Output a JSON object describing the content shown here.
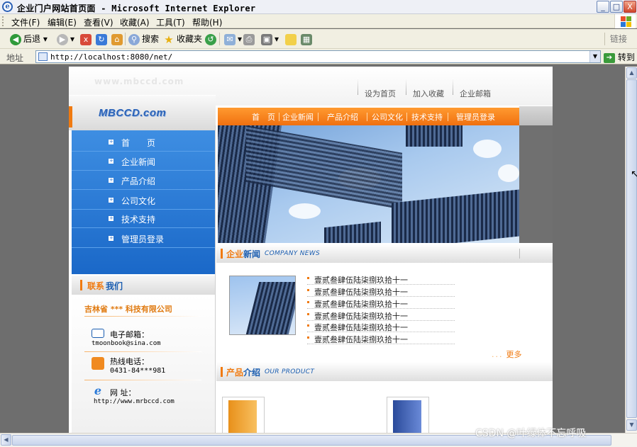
{
  "window": {
    "title": "企业门户网站首页面 - Microsoft Internet Explorer",
    "buttons": [
      "_",
      "□",
      "X"
    ]
  },
  "menu": [
    "文件(F)",
    "编辑(E)",
    "查看(V)",
    "收藏(A)",
    "工具(T)",
    "帮助(H)"
  ],
  "toolbar": {
    "back": "后退",
    "search": "搜索",
    "favorites": "收藏夹",
    "links": "链接"
  },
  "address": {
    "label": "地址",
    "url": "http://localhost:8080/net/",
    "go": "转到"
  },
  "site": {
    "watermark": "www.mbccd.com",
    "top_links": [
      "设为首页",
      "加入收藏",
      "企业邮箱"
    ],
    "logo": "MBCCD.com",
    "nav": [
      "首　页",
      "企业新闻",
      "产品介绍",
      "公司文化",
      "技术支持",
      "管理员登录"
    ],
    "side_menu": [
      "首　　页",
      "企业新闻",
      "产品介绍",
      "公司文化",
      "技术支持",
      "管理员登录"
    ],
    "contact": {
      "title_a": "联系",
      "title_b": "我们",
      "company": "吉林省 *** 科技有限公司",
      "email_label": "电子邮箱：",
      "email": "tmoonbook@sina.com",
      "phone_label": "热线电话：",
      "phone": "0431-84***981",
      "web_label": "网 址：",
      "web": "http://www.mrbccd.com"
    },
    "news": {
      "title_a": "企业",
      "title_b": "新闻",
      "title_en": "COMPANY NEWS",
      "items": [
        "壹贰叁肆伍陆柒捌玖拾十一",
        "壹贰叁肆伍陆柒捌玖拾十一",
        "壹贰叁肆伍陆柒捌玖拾十一",
        "壹贰叁肆伍陆柒捌玖拾十一",
        "壹贰叁肆伍陆柒捌玖拾十一",
        "壹贰叁肆伍陆柒捌玖拾十一"
      ],
      "more_dots": "...",
      "more": "更多"
    },
    "products": {
      "title_a": "产品",
      "title_b": "介绍",
      "title_en": "OUR PRODUCT"
    }
  },
  "watermark_text": "CSDN @叶绿体不忘呼吸",
  "colors": {
    "accent_orange": "#f07a10",
    "nav_blue": "#1a68c8",
    "title_blue": "#1a5db0"
  }
}
